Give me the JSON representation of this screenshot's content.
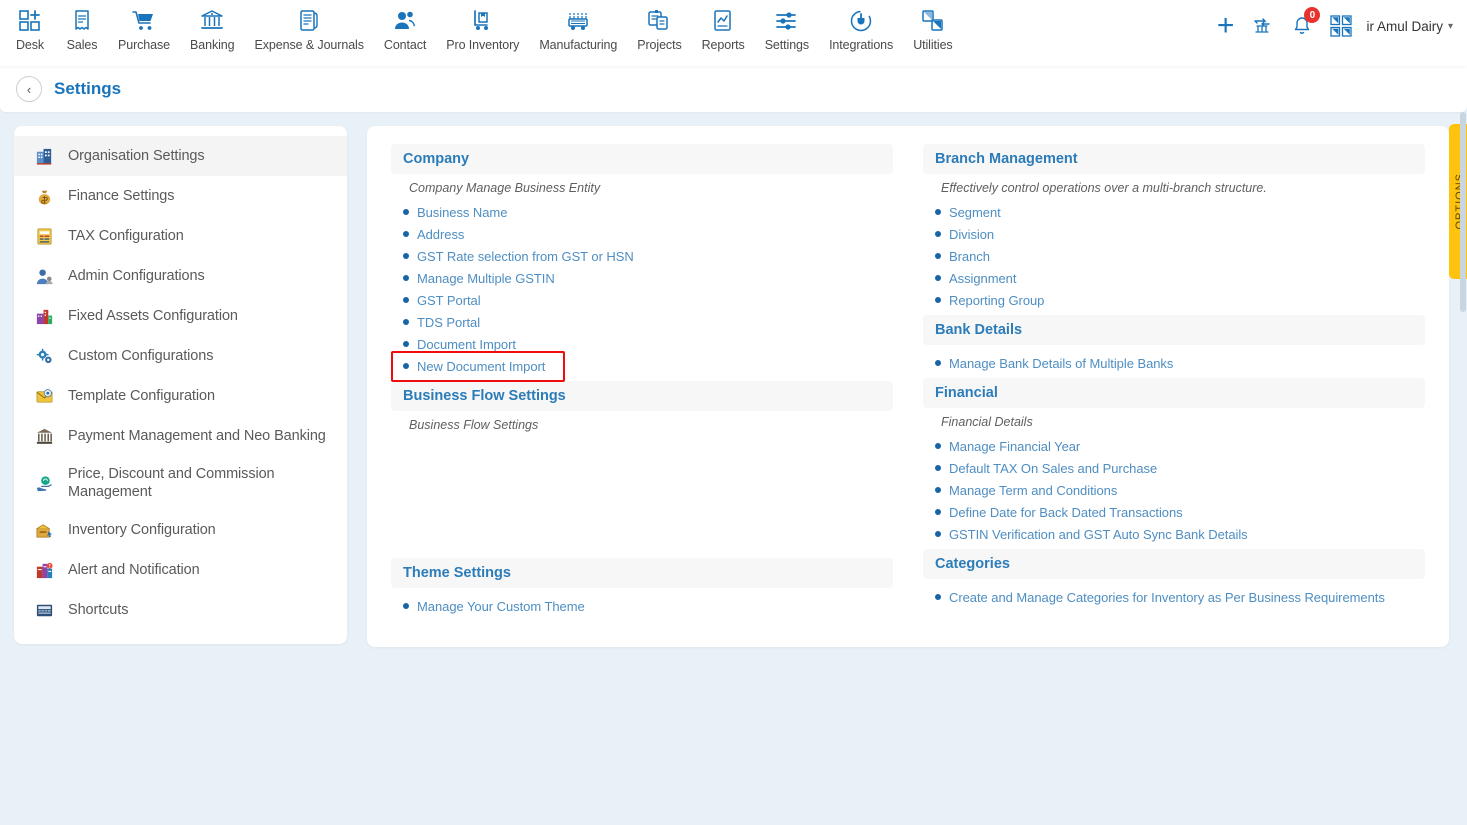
{
  "topnav": {
    "items": [
      {
        "label": "Desk",
        "icon": "dashboard-grid-plus-icon"
      },
      {
        "label": "Sales",
        "icon": "receipt-icon"
      },
      {
        "label": "Purchase",
        "icon": "shopping-cart-icon"
      },
      {
        "label": "Banking",
        "icon": "bank-building-icon"
      },
      {
        "label": "Expense & Journals",
        "icon": "journal-book-icon"
      },
      {
        "label": "Contact",
        "icon": "people-icon"
      },
      {
        "label": "Pro Inventory",
        "icon": "hand-truck-icon"
      },
      {
        "label": "Manufacturing",
        "icon": "factory-machine-icon"
      },
      {
        "label": "Projects",
        "icon": "project-clipboard-icon"
      },
      {
        "label": "Reports",
        "icon": "report-chart-icon"
      },
      {
        "label": "Settings",
        "icon": "sliders-icon"
      },
      {
        "label": "Integrations",
        "icon": "plug-power-icon"
      },
      {
        "label": "Utilities",
        "icon": "utilities-shapes-icon"
      }
    ],
    "right": {
      "add_icon": "plus-icon",
      "transfer_icon": "bank-transfer-icon",
      "notification_icon": "bell-icon",
      "notification_count": "0",
      "apps_icon": "apps-grid-icon",
      "org_name": "ir Amul Dairy",
      "org_chevron": "chevron-down-icon"
    }
  },
  "page_header": {
    "back_icon": "chevron-left-icon",
    "title": "Settings"
  },
  "sidebar": {
    "items": [
      {
        "label": "Organisation Settings",
        "icon": "organisation-building-icon",
        "active": true
      },
      {
        "label": "Finance Settings",
        "icon": "money-bag-icon",
        "active": false
      },
      {
        "label": "TAX Configuration",
        "icon": "tax-document-icon",
        "active": false
      },
      {
        "label": "Admin Configurations",
        "icon": "admin-user-icon",
        "active": false
      },
      {
        "label": "Fixed Assets Configuration",
        "icon": "fixed-assets-icon",
        "active": false
      },
      {
        "label": "Custom Configurations",
        "icon": "gears-icon",
        "active": false
      },
      {
        "label": "Template Configuration",
        "icon": "template-envelope-icon",
        "active": false
      },
      {
        "label": "Payment Management and Neo Banking",
        "icon": "bank-classical-icon",
        "active": false
      },
      {
        "label": "Price, Discount and Commission Management",
        "icon": "price-hand-icon",
        "active": false
      },
      {
        "label": "Inventory Configuration",
        "icon": "inventory-box-icon",
        "active": false
      },
      {
        "label": "Alert and Notification",
        "icon": "alert-icon",
        "active": false
      },
      {
        "label": "Shortcuts",
        "icon": "shortcuts-keyboard-icon",
        "active": false
      }
    ]
  },
  "content": {
    "left_sections": [
      {
        "title": "Company",
        "subtitle": "Company Manage Business Entity",
        "links": [
          {
            "label": "Business Name",
            "highlight": false
          },
          {
            "label": "Address",
            "highlight": false
          },
          {
            "label": "GST Rate selection from GST or HSN",
            "highlight": false
          },
          {
            "label": "Manage Multiple GSTIN",
            "highlight": false
          },
          {
            "label": "GST Portal",
            "highlight": false
          },
          {
            "label": "TDS Portal",
            "highlight": false
          },
          {
            "label": "Document Import",
            "highlight": false
          },
          {
            "label": "New Document Import",
            "highlight": true
          }
        ]
      },
      {
        "title": "Business Flow Settings",
        "subtitle": "Business Flow Settings",
        "links": []
      },
      {
        "title": "Theme Settings",
        "subtitle": "",
        "links": [
          {
            "label": "Manage Your Custom Theme",
            "highlight": false
          }
        ]
      }
    ],
    "right_sections": [
      {
        "title": "Branch Management",
        "subtitle": "Effectively control operations over a multi-branch structure.",
        "links": [
          {
            "label": "Segment",
            "highlight": false
          },
          {
            "label": "Division",
            "highlight": false
          },
          {
            "label": "Branch",
            "highlight": false
          },
          {
            "label": "Assignment",
            "highlight": false
          },
          {
            "label": "Reporting Group",
            "highlight": false
          }
        ]
      },
      {
        "title": "Bank Details",
        "subtitle": "",
        "links": [
          {
            "label": "Manage Bank Details of Multiple Banks",
            "highlight": false
          }
        ]
      },
      {
        "title": "Financial",
        "subtitle": "Financial Details",
        "links": [
          {
            "label": "Manage Financial Year",
            "highlight": false
          },
          {
            "label": "Default TAX On Sales and Purchase",
            "highlight": false
          },
          {
            "label": "Manage Term and Conditions",
            "highlight": false
          },
          {
            "label": "Define Date for Back Dated Transactions",
            "highlight": false
          },
          {
            "label": "GSTIN Verification and GST Auto Sync Bank Details",
            "highlight": false
          }
        ]
      },
      {
        "title": "Categories",
        "subtitle": "",
        "links": [
          {
            "label": "Create and Manage Categories for Inventory as Per Business Requirements",
            "highlight": false
          }
        ]
      }
    ]
  },
  "options_tab": {
    "label": "OPTIONS",
    "color": "#ffc20e"
  },
  "colors": {
    "page_background": "#e9f1f8",
    "accent_blue": "#1a74bb",
    "link_blue": "#4e8ec2",
    "section_header_bg": "#f7f7f7",
    "highlight_red": "#f00c0c",
    "badge_red": "#e8322d"
  }
}
